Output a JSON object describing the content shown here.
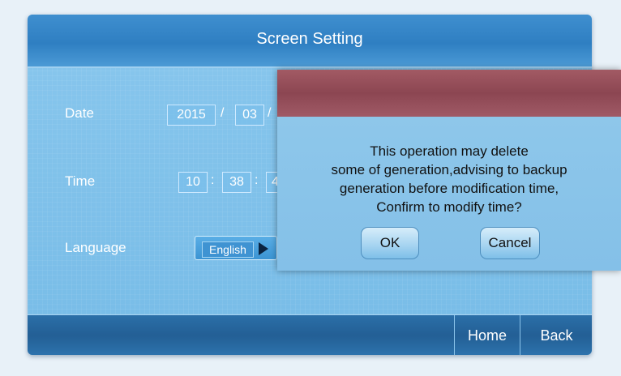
{
  "title": "Screen Setting",
  "date": {
    "label": "Date",
    "year": "2015",
    "month": "03",
    "sep": "/"
  },
  "time": {
    "label": "Time",
    "hour": "10",
    "minute": "38",
    "second_partial": "4",
    "sep": ":"
  },
  "language": {
    "label": "Language",
    "value": "English"
  },
  "nav": {
    "home": "Home",
    "back": "Back"
  },
  "dialog": {
    "line1": "This operation may delete",
    "line2": "some of generation,advising to backup",
    "line3": "generation before modification time,",
    "line4": "Confirm to modify time?",
    "ok": "OK",
    "cancel": "Cancel"
  },
  "colors": {
    "title_bar": "#2f7fc2",
    "panel": "#7bbde6",
    "dialog_header": "#8c4652"
  }
}
